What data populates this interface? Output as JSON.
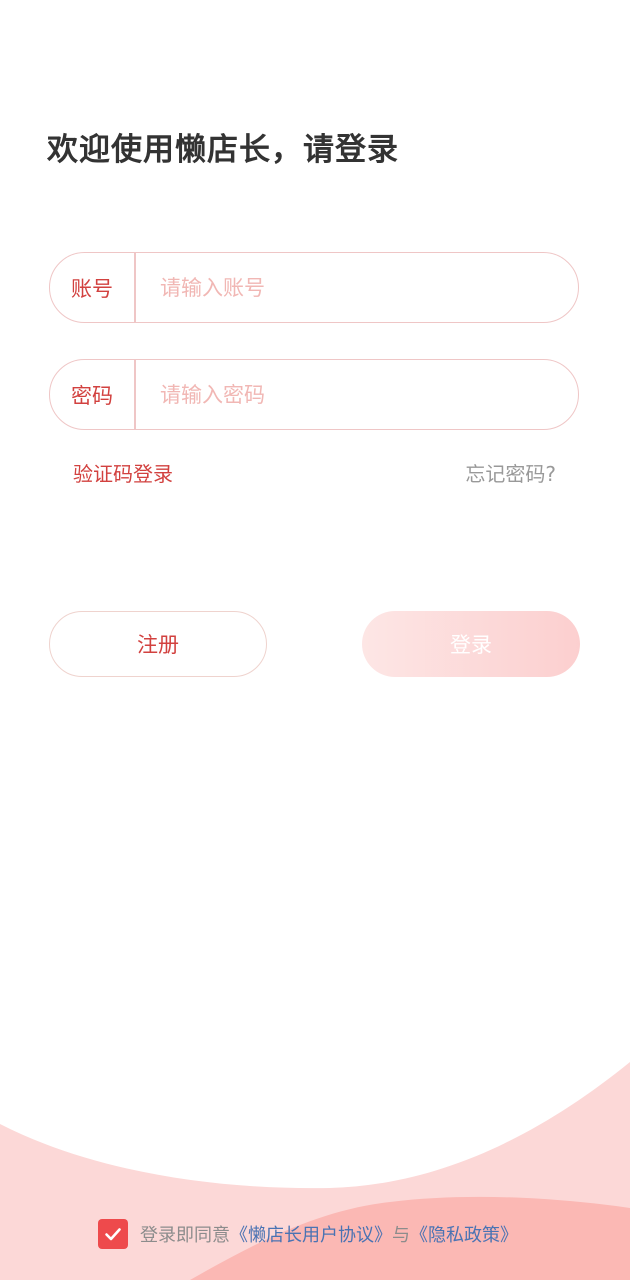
{
  "title": "欢迎使用懒店长，请登录",
  "account": {
    "label": "账号",
    "placeholder": "请输入账号",
    "value": ""
  },
  "password": {
    "label": "密码",
    "placeholder": "请输入密码",
    "value": ""
  },
  "links": {
    "sms_login": "验证码登录",
    "forgot_password": "忘记密码?"
  },
  "buttons": {
    "register": "注册",
    "login": "登录"
  },
  "agreement": {
    "checked": true,
    "prefix": "登录即同意",
    "user_agreement": "《懒店长用户协议》",
    "separator": "与",
    "privacy_policy": "《隐私政策》"
  },
  "colors": {
    "accent": "#d2413f",
    "checkbox": "#ee4a4c",
    "link_blue": "#4a73b3",
    "wave_light": "#fcd8d7",
    "wave_dark": "#fbb8b4"
  },
  "icons": {
    "checkbox": "check-icon"
  }
}
